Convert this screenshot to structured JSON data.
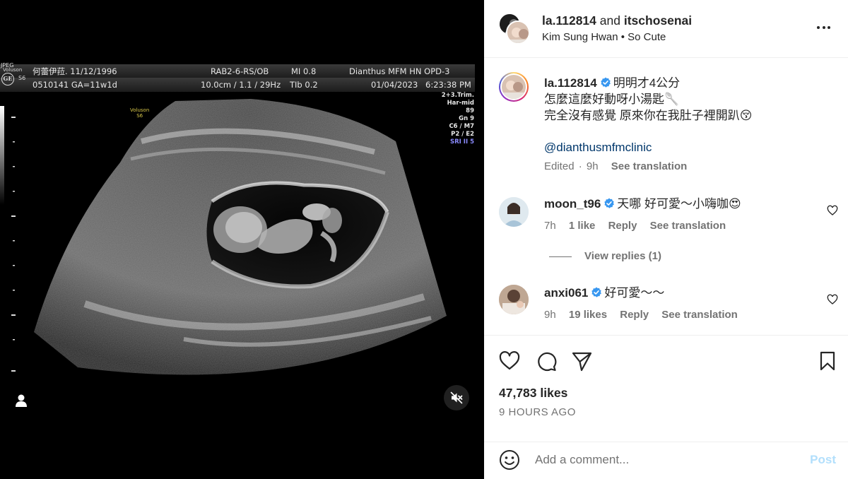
{
  "media": {
    "ultrasound": {
      "corner_brand": "JPEG",
      "corner_brand2": "Voluson",
      "corner_model": "S6",
      "logo": "GE",
      "patient_name": "何蕾伊菈. 11/12/1996",
      "patient_id": "0510141  GA=11w1d",
      "probe": "RAB2-6-RS/OB",
      "depth_info": "10.0cm / 1.1 / 29Hz",
      "mi": "MI  0.8",
      "tib": "TIb  0.2",
      "clinic": "Dianthus MFM HN OPD-3",
      "date": "01/04/2023",
      "time": "6:23:38 PM",
      "params": [
        "2+3.Trim.",
        "Har-mid",
        "89",
        "Gn   9",
        "C6 / M7",
        "P2 / E2",
        "SRI II 5"
      ],
      "small_brand": "Voluson",
      "small_model": "S6"
    },
    "mute_icon": "speaker-muted-icon",
    "user_icon": "user-tag-icon"
  },
  "header": {
    "user1": "la.112814",
    "and_text": "and",
    "user2": "itschosenai",
    "audio_artist": "Kim Sung Hwan",
    "separator": "•",
    "audio_title": "So Cute",
    "more_icon": "more-options-icon"
  },
  "caption": {
    "username": "la.112814",
    "line1": "明明才4公分",
    "line2": "怎麼這麼好動呀小湯匙🥄",
    "line3": "完全沒有感覺 原來你在我肚子裡開趴😚",
    "mention": "@dianthusmfmclinic",
    "edited": "Edited",
    "dot": "·",
    "time": "9h",
    "see_translation": "See translation"
  },
  "comments": [
    {
      "username": "moon_t96",
      "text": "天哪 好可愛～小嗨咖😍",
      "time": "7h",
      "likes": "1 like",
      "reply": "Reply",
      "see_translation": "See translation"
    },
    {
      "username": "anxi061",
      "text": "好可愛～～",
      "time": "9h",
      "likes": "19 likes",
      "reply": "Reply",
      "see_translation": "See translation"
    }
  ],
  "view_replies": "View replies (1)",
  "actions": {
    "likes": "47,783 likes",
    "posted": "9 HOURS AGO",
    "icons": [
      "heart-icon",
      "comment-icon",
      "share-icon",
      "bookmark-icon"
    ]
  },
  "add_comment": {
    "placeholder": "Add a comment...",
    "post_label": "Post"
  },
  "colors": {
    "verified": "#3897f0",
    "link": "#00376b",
    "muted": "#737373",
    "post_disabled": "#b2dffc"
  }
}
